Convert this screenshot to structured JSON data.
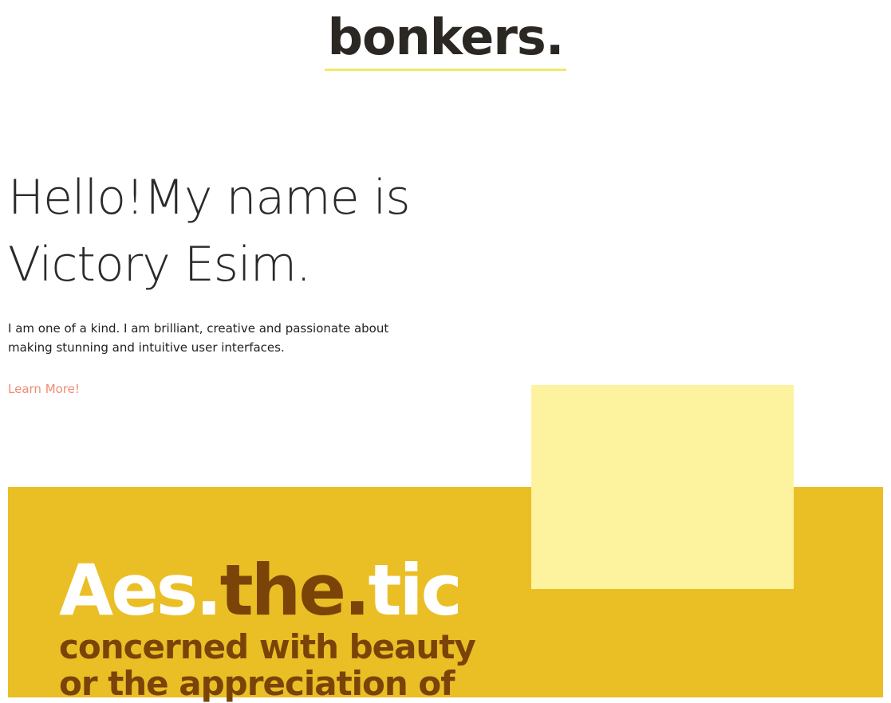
{
  "header": {
    "logo_text": "bonkers."
  },
  "hero": {
    "title": "Hello!My name is Victory Esim.",
    "description": "I am one of a kind. I am brilliant, creative and passionate about making stunning and intuitive user interfaces.",
    "cta_label": "Learn More!"
  },
  "aesthetic": {
    "title_part_1": "Aes.",
    "title_part_2": "the.",
    "title_part_3": "tic",
    "definition": "concerned with beauty or the appreciation of"
  },
  "colors": {
    "logo_underline": "#f2e96a",
    "cta_link": "#f08c73",
    "section_background": "#eabe25",
    "light_block": "#fdf39e",
    "accent_brown": "#7a4308",
    "white": "#ffffff"
  }
}
